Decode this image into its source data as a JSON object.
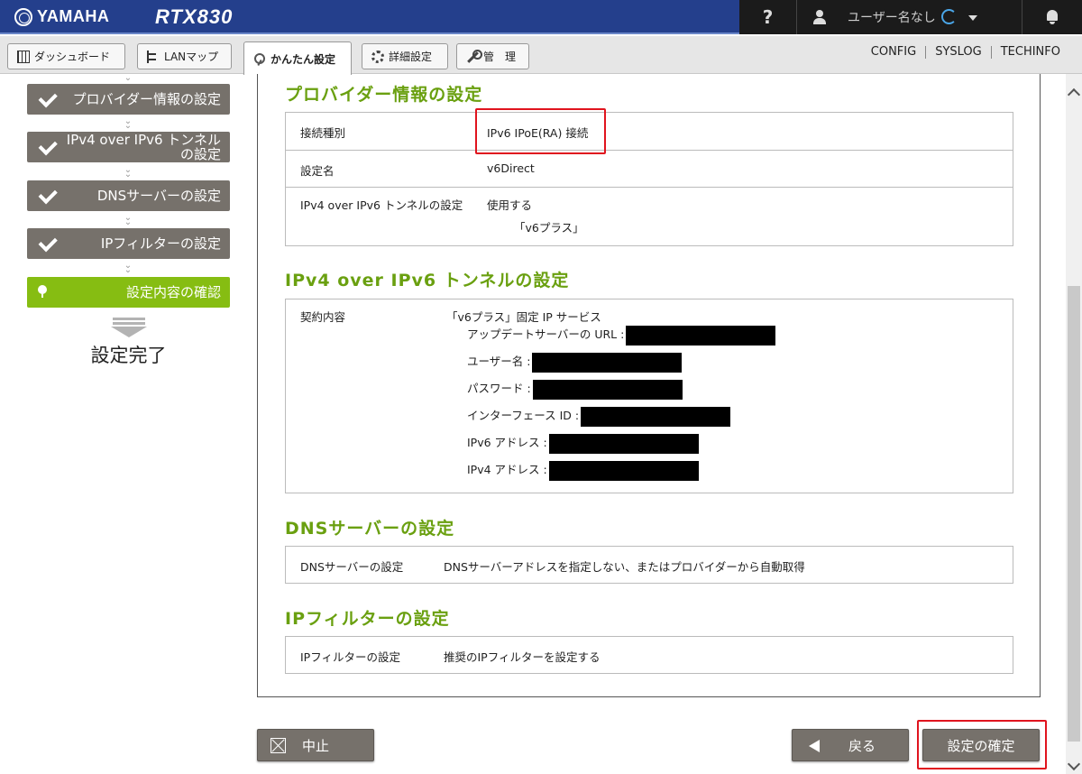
{
  "header": {
    "brand": "YAMAHA",
    "model": "RTX830",
    "help": "?",
    "user": "ユーザー名なし"
  },
  "tabs": [
    {
      "label": "ダッシュボード"
    },
    {
      "label": "LANマップ"
    },
    {
      "label": "かんたん設定"
    },
    {
      "label": "詳細設定"
    },
    {
      "label": "管　理"
    }
  ],
  "top_links": [
    "CONFIG",
    "SYSLOG",
    "TECHINFO"
  ],
  "steps": [
    {
      "label": "プロバイダー情報の設定",
      "state": "done"
    },
    {
      "label": "IPv4 over IPv6 トンネルの設定",
      "state": "done"
    },
    {
      "label": "DNSサーバーの設定",
      "state": "done"
    },
    {
      "label": "IPフィルターの設定",
      "state": "done"
    },
    {
      "label": "設定内容の確認",
      "state": "current"
    },
    {
      "label": "設定完了",
      "state": "pending"
    }
  ],
  "sections": {
    "provider": {
      "title": "プロバイダー情報の設定",
      "rows": [
        {
          "label": "接続種別",
          "value": "IPv6 IPoE(RA) 接続"
        },
        {
          "label": "設定名",
          "value": "v6Direct"
        },
        {
          "label": "IPv4 over IPv6 トンネルの設定",
          "value": "使用する",
          "value2": "「v6プラス」"
        }
      ]
    },
    "tunnel": {
      "title": "IPv4 over IPv6 トンネルの設定",
      "label": "契約内容",
      "value": "「v6プラス」固定 IP サービス",
      "items": [
        {
          "label": "アップデートサーバーの URL :"
        },
        {
          "label": "ユーザー名 :"
        },
        {
          "label": "パスワード :"
        },
        {
          "label": "インターフェース ID :"
        },
        {
          "label": "IPv6 アドレス :"
        },
        {
          "label": "IPv4 アドレス :"
        }
      ]
    },
    "dns": {
      "title": "DNSサーバーの設定",
      "label": "DNSサーバーの設定",
      "value": "DNSサーバーアドレスを指定しない、またはプロバイダーから自動取得"
    },
    "filter": {
      "title": "IPフィルターの設定",
      "label": "IPフィルターの設定",
      "value": "推奨のIPフィルターを設定する"
    }
  },
  "buttons": {
    "cancel": "中止",
    "back": "戻る",
    "confirm": "設定の確定"
  },
  "colors": {
    "header": "#243f8c",
    "step_done": "#76716b",
    "step_current": "#86bd12",
    "section_title": "#6aa010",
    "highlight": "#e0141e"
  }
}
